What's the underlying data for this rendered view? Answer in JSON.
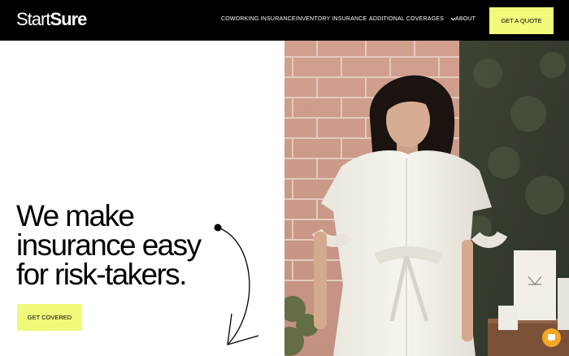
{
  "brand": {
    "logo_light": "Start",
    "logo_bold": "Sure"
  },
  "nav": {
    "links": [
      "COWORKING INSURANCE",
      "INVENTORY INSURANCE",
      "ADDITIONAL COVERAGES",
      "ABOUT"
    ],
    "quote_button": "GET A QUOTE"
  },
  "hero": {
    "title_lines": [
      "We make",
      "insurance easy",
      "for risk-takers."
    ],
    "cta_label": "GET COVERED"
  },
  "colors": {
    "accent": "#f1fb7b",
    "nav_bg": "#000000",
    "chat": "#f5a623"
  },
  "icons": [
    "chevron-down-icon",
    "curved-arrow-icon",
    "chat-icon"
  ]
}
